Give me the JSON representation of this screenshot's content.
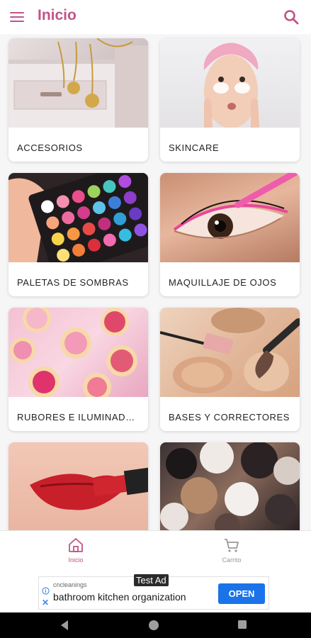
{
  "header": {
    "title": "Inicio"
  },
  "categories": [
    {
      "label": "ACCESORIOS",
      "image": "jewelry-box-photo"
    },
    {
      "label": "SKINCARE",
      "image": "face-patches-photo"
    },
    {
      "label": "PALETAS DE SOMBRAS",
      "image": "eyeshadow-palette-photo"
    },
    {
      "label": "MAQUILLAJE DE OJOS",
      "image": "eyeliner-photo"
    },
    {
      "label": "RUBORES E ILUMINADORES",
      "image": "blush-compacts-photo"
    },
    {
      "label": "BASES Y CORRECTORES",
      "image": "foundation-photo"
    },
    {
      "label": "",
      "image": "lipstick-photo"
    },
    {
      "label": "",
      "image": "makeup-brushes-photo"
    }
  ],
  "bottom_nav": {
    "home_label": "Inicio",
    "cart_label": "Carrito"
  },
  "ad": {
    "tag": "Test Ad",
    "brand": "cncleanings",
    "text": "bathroom kitchen organization",
    "cta": "OPEN"
  },
  "colors": {
    "accent": "#c0548a",
    "ad_button": "#1a73e8"
  }
}
